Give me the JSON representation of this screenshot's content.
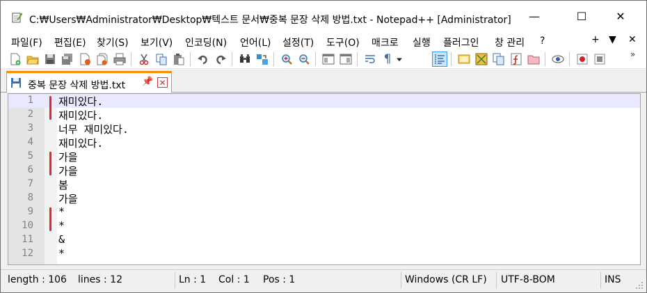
{
  "window": {
    "title": "C:₩Users₩Administrator₩Desktop₩텍스트 문서₩중복 문장 삭제 방법.txt - Notepad++ [Administrator]",
    "min_glyph": "—",
    "max_glyph": "☐",
    "close_glyph": "✕"
  },
  "menu": {
    "items": [
      "파일(F)",
      "편집(E)",
      "찾기(S)",
      "보기(V)",
      "인코딩(N)",
      "언어(L)",
      "설정(T)",
      "도구(O)",
      "매크로",
      "실행",
      "플러그인",
      "창 관리",
      "?"
    ],
    "right": [
      "+",
      "▼",
      "✕"
    ]
  },
  "toolbar": {
    "icons": [
      "new-file-icon",
      "open-file-icon",
      "save-icon",
      "save-all-icon",
      "close-icon",
      "close-all-icon",
      "print-icon",
      "cut-icon",
      "copy-icon",
      "paste-icon",
      "undo-icon",
      "redo-icon",
      "find-icon",
      "replace-icon",
      "zoom-in-icon",
      "zoom-out-icon",
      "sync-vertical-icon",
      "sync-horizontal-icon",
      "word-wrap-icon",
      "show-all-chars-icon",
      "indent-guide-icon",
      "user-defined-lang-icon",
      "doc-map-icon",
      "doc-list-icon",
      "function-list-icon",
      "folder-workspace-icon",
      "monitoring-icon",
      "record-macro-icon",
      "stop-record-icon"
    ],
    "more": "»",
    "pilcrow": "¶"
  },
  "tab": {
    "label": "중복 문장 삭제 방법.txt",
    "pin": "📌",
    "close": "✕"
  },
  "editor": {
    "accent": "#e8212b",
    "current_line_color": "#e8e8ff",
    "lines": [
      {
        "num": "1",
        "text": "재미있다."
      },
      {
        "num": "2",
        "text": "재미있다."
      },
      {
        "num": "3",
        "text": "너무 재미있다."
      },
      {
        "num": "4",
        "text": "재미있다."
      },
      {
        "num": "5",
        "text": "가을"
      },
      {
        "num": "6",
        "text": "가을"
      },
      {
        "num": "7",
        "text": "봄"
      },
      {
        "num": "8",
        "text": "가을"
      },
      {
        "num": "9",
        "text": "*"
      },
      {
        "num": "10",
        "text": "*"
      },
      {
        "num": "11",
        "text": "&"
      },
      {
        "num": "12",
        "text": "*"
      }
    ]
  },
  "status": {
    "length": "length : 106",
    "lines": "lines : 12",
    "ln": "Ln : 1",
    "col": "Col : 1",
    "pos": "Pos : 1",
    "eol": "Windows (CR LF)",
    "encoding": "UTF-8-BOM",
    "mode": "INS"
  }
}
